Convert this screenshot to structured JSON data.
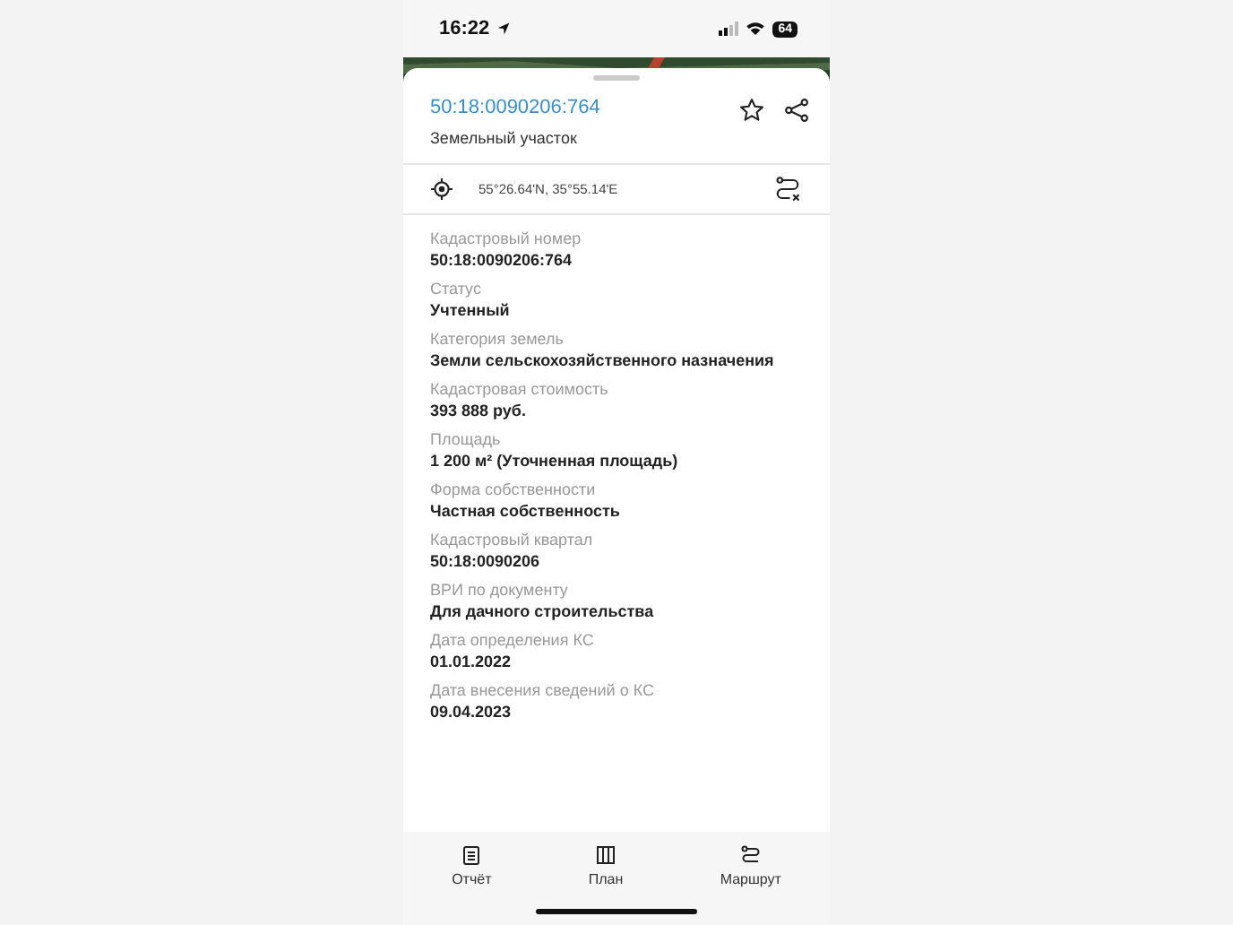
{
  "status_bar": {
    "time": "16:22",
    "battery": "64"
  },
  "header": {
    "title": "50:18:0090206:764",
    "subtitle": "Земельный участок"
  },
  "coordinates": "55°26.64'N, 35°55.14'E",
  "fields": [
    {
      "label": "Кадастровый номер",
      "value": "50:18:0090206:764"
    },
    {
      "label": "Статус",
      "value": "Учтенный"
    },
    {
      "label": "Категория земель",
      "value": "Земли сельскохозяйственного назначения"
    },
    {
      "label": "Кадастровая стоимость",
      "value": "393 888 руб."
    },
    {
      "label": "Площадь",
      "value": "1 200 м² (Уточненная площадь)"
    },
    {
      "label": "Форма собственности",
      "value": "Частная собственность"
    },
    {
      "label": "Кадастровый квартал",
      "value": "50:18:0090206"
    },
    {
      "label": "ВРИ по документу",
      "value": "Для дачного строительства"
    },
    {
      "label": "Дата определения КС",
      "value": "01.01.2022"
    },
    {
      "label": "Дата внесения сведений о КС",
      "value": "09.04.2023"
    }
  ],
  "bottom_nav": [
    {
      "label": "Отчёт",
      "kind": "report"
    },
    {
      "label": "План",
      "kind": "plan"
    },
    {
      "label": "Маршрут",
      "kind": "route"
    }
  ]
}
